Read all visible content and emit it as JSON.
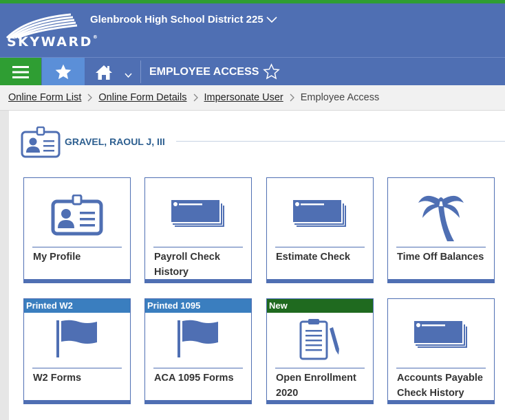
{
  "colors": {
    "brand_blue": "#4f6fb3",
    "nav_green": "#2f9e33",
    "fav_blue": "#5b8fd8",
    "banner_blue": "#3a7ebf",
    "banner_green": "#1f6a1f",
    "name_blue": "#2c5e8f"
  },
  "header": {
    "logo_text": "SKYWARD",
    "district": "Glenbrook High School District 225"
  },
  "navbar": {
    "menu_icon": "hamburger-icon",
    "favorites_icon": "star-icon",
    "home_icon": "home-icon",
    "title": "EMPLOYEE ACCESS",
    "title_icon": "star-outline-icon"
  },
  "breadcrumb": {
    "items": [
      "Online Form List",
      "Online Form Details",
      "Impersonate User"
    ],
    "current": "Employee Access"
  },
  "user": {
    "name": "GRAVEL, RAOUL J, III",
    "icon": "id-badge-icon"
  },
  "tiles": [
    {
      "label": "My Profile",
      "icon": "id-badge-icon",
      "banner": ""
    },
    {
      "label": "Payroll Check History",
      "icon": "check-icon",
      "banner": ""
    },
    {
      "label": "Estimate Check",
      "icon": "check-icon",
      "banner": ""
    },
    {
      "label": "Time Off Balances",
      "icon": "palm-tree-icon",
      "banner": ""
    },
    {
      "label": "W2 Forms",
      "icon": "flag-icon",
      "banner": "Printed W2"
    },
    {
      "label": "ACA 1095 Forms",
      "icon": "flag-icon",
      "banner": "Printed 1095"
    },
    {
      "label": "Open Enrollment 2020",
      "icon": "clipboard-icon",
      "banner": "New"
    },
    {
      "label": "Accounts Payable Check History",
      "icon": "check-icon",
      "banner": ""
    }
  ]
}
